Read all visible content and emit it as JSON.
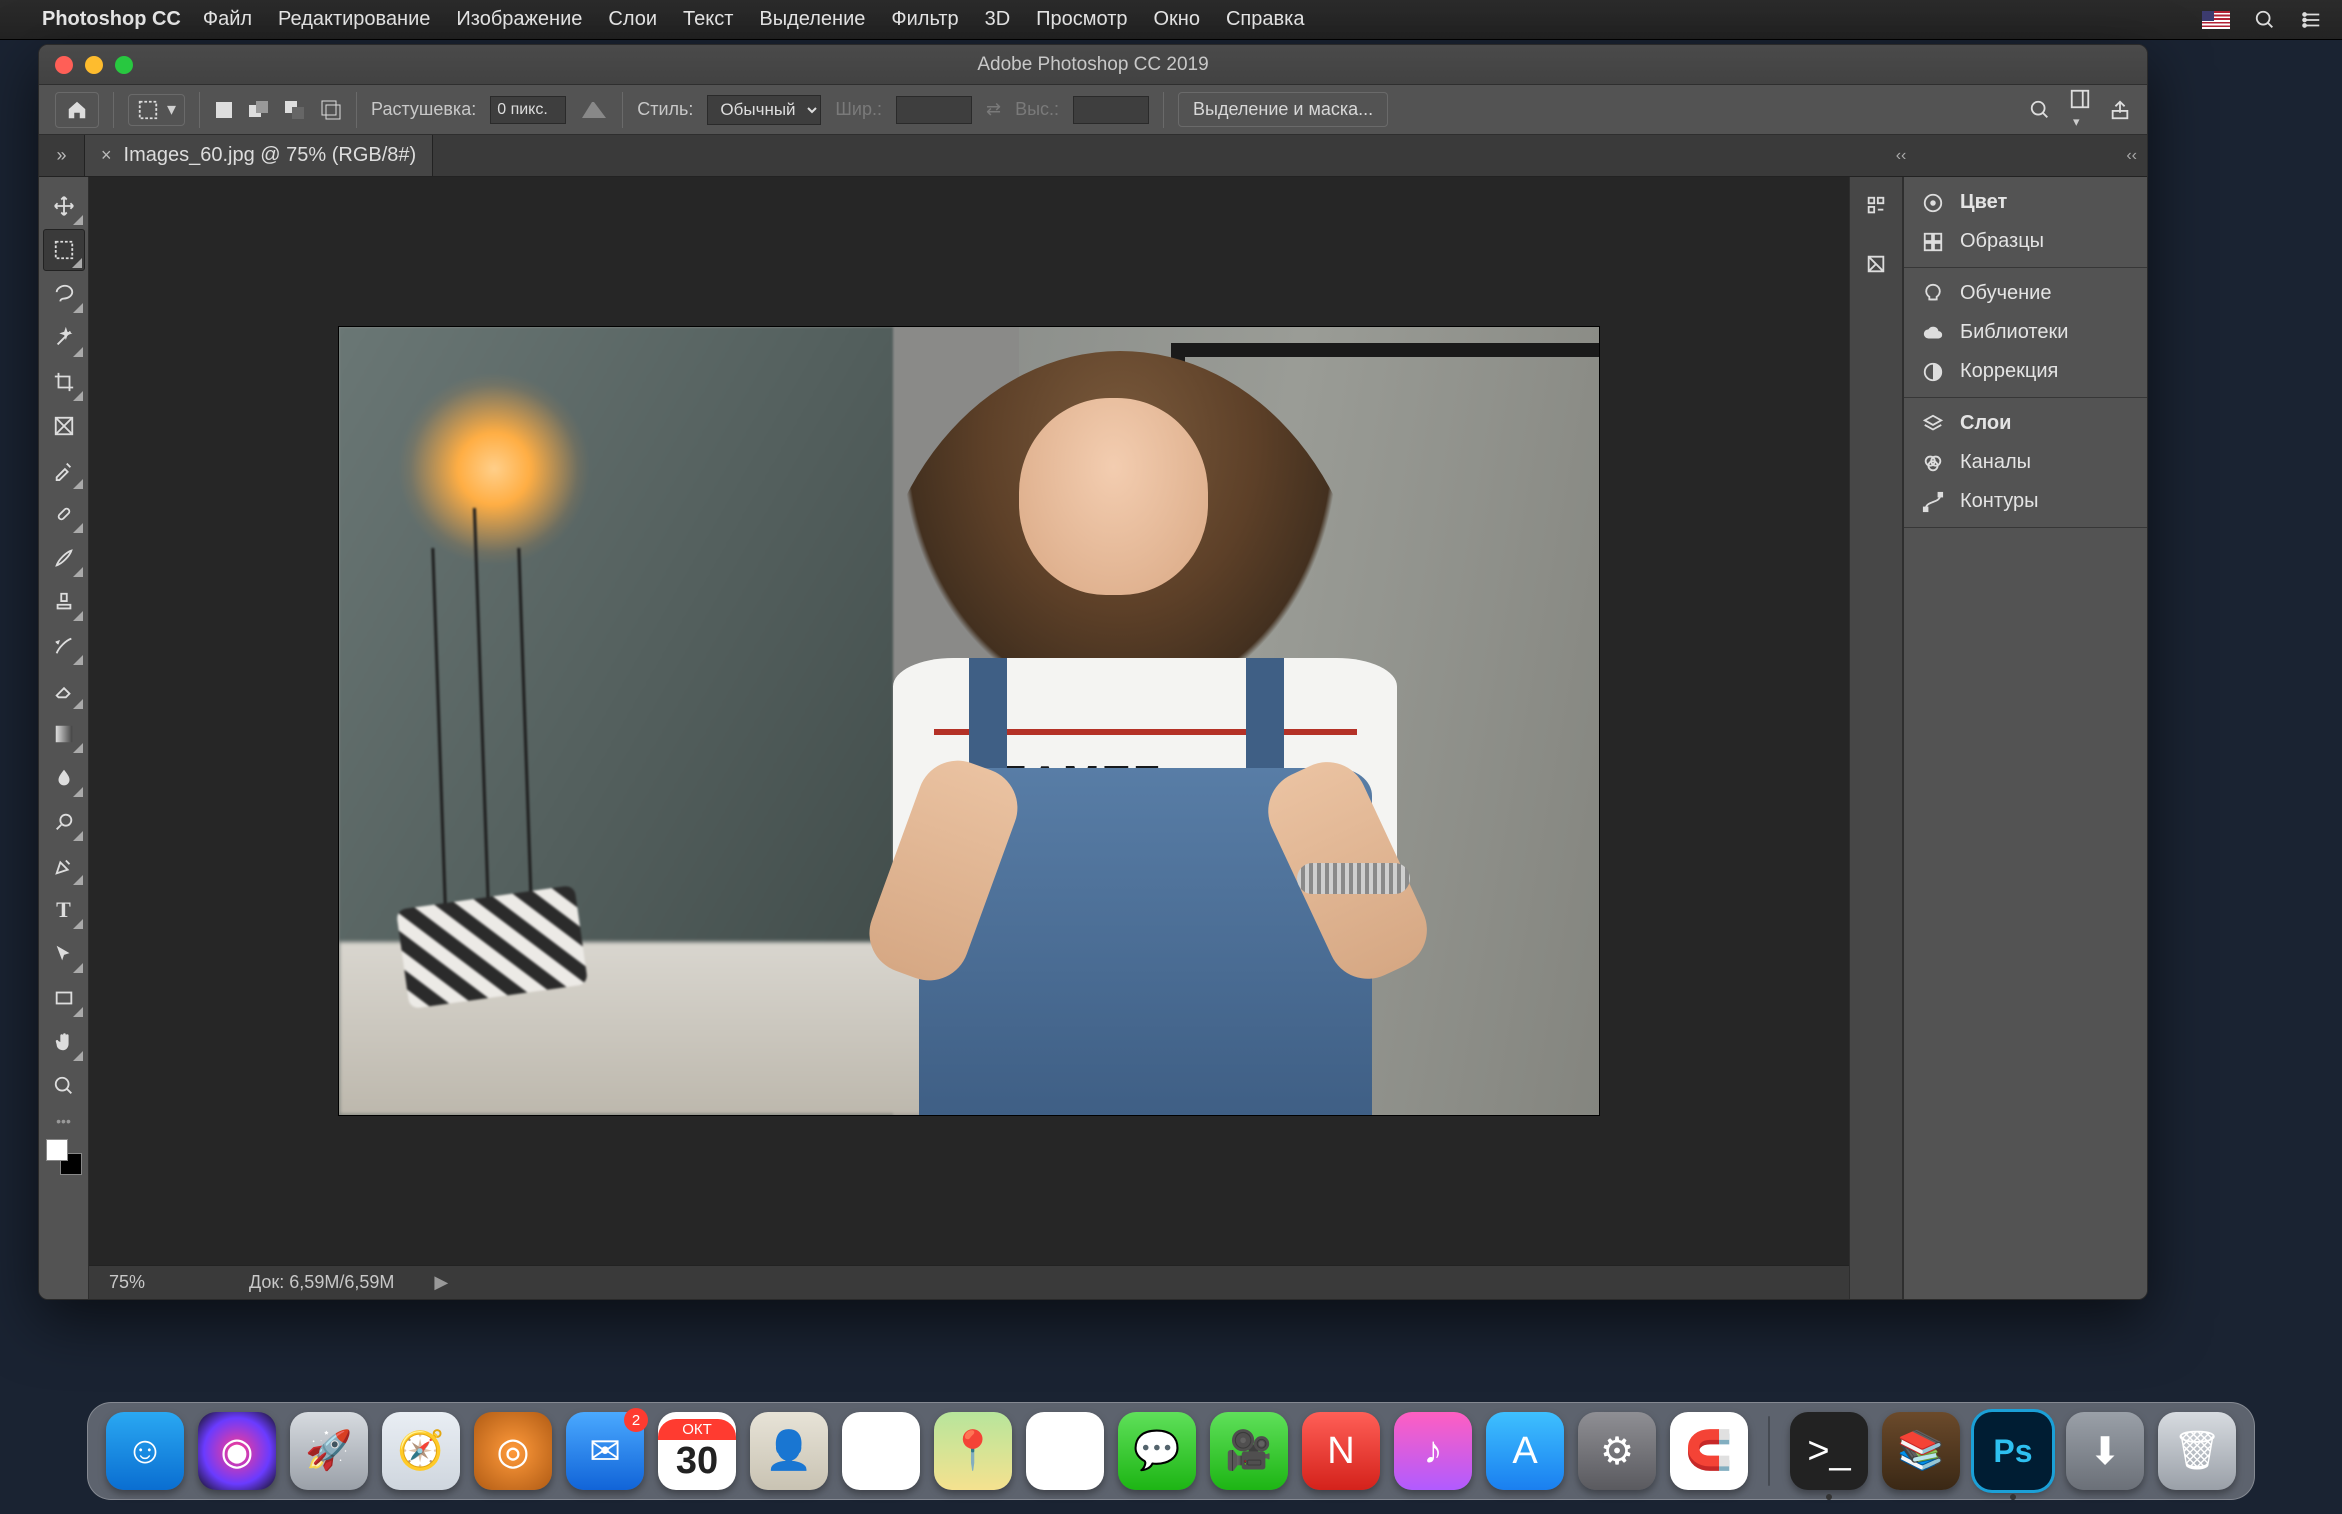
{
  "mac_menu": {
    "app_name": "Photoshop CC",
    "items": [
      "Файл",
      "Редактирование",
      "Изображение",
      "Слои",
      "Текст",
      "Выделение",
      "Фильтр",
      "3D",
      "Просмотр",
      "Окно",
      "Справка"
    ]
  },
  "window": {
    "title": "Adobe Photoshop CC 2019"
  },
  "options": {
    "feather_label": "Растушевка:",
    "feather_value": "0 пикс.",
    "style_label": "Стиль:",
    "style_value": "Обычный",
    "width_label": "Шир.:",
    "height_label": "Выс.:",
    "mask_button": "Выделение и маска..."
  },
  "document_tab": {
    "label": "Images_60.jpg @ 75% (RGB/8#)",
    "close": "×"
  },
  "status": {
    "zoom": "75%",
    "doc_label": "Док:",
    "doc_value": "6,59M/6,59M",
    "tri": "▶"
  },
  "panels": {
    "group1": [
      "Цвет",
      "Образцы"
    ],
    "group2": [
      "Обучение",
      "Библиотеки",
      "Коррекция"
    ],
    "group3": [
      "Слои",
      "Каналы",
      "Контуры"
    ]
  },
  "toolbox": {
    "tools": [
      "move",
      "marquee",
      "lasso",
      "magic-wand",
      "crop",
      "frame",
      "eyedropper",
      "healing",
      "brush",
      "stamp",
      "history-brush",
      "eraser",
      "gradient",
      "blur",
      "dodge",
      "pen",
      "type",
      "path-select",
      "rectangle",
      "hand",
      "zoom"
    ],
    "active": "marquee"
  },
  "photo": {
    "shirt_text": "REAMEF"
  },
  "dock": {
    "items": [
      {
        "name": "finder",
        "bg": "linear-gradient(#2aa8f2,#0a6ed1)",
        "glyph": "☺"
      },
      {
        "name": "siri",
        "bg": "radial-gradient(circle,#ff3b8d,#6a3bff 60%,#111)",
        "glyph": "◉"
      },
      {
        "name": "launchpad",
        "bg": "linear-gradient(#d7dbe0,#9aa0a8)",
        "glyph": "🚀"
      },
      {
        "name": "safari",
        "bg": "linear-gradient(#e9eef4,#cfd6de)",
        "glyph": "🧭"
      },
      {
        "name": "showcase",
        "bg": "radial-gradient(circle,#ff9a3b,#b05b14)",
        "glyph": "◎"
      },
      {
        "name": "mail",
        "bg": "linear-gradient(#4aa9ff,#1164d8)",
        "glyph": "✉",
        "badge": "2"
      },
      {
        "name": "calendar",
        "bg": "#fff",
        "glyph": "",
        "badge": null
      },
      {
        "name": "contacts",
        "bg": "linear-gradient(#e7e3d7,#c9c3b3)",
        "glyph": "👤"
      },
      {
        "name": "reminders",
        "bg": "#fff",
        "glyph": "☲"
      },
      {
        "name": "maps",
        "bg": "linear-gradient(#b7e59b,#f5e28f)",
        "glyph": "📍"
      },
      {
        "name": "photos",
        "bg": "#fff",
        "glyph": "✿"
      },
      {
        "name": "messages",
        "bg": "linear-gradient(#5fe05a,#1db514)",
        "glyph": "💬"
      },
      {
        "name": "facetime",
        "bg": "linear-gradient(#5fe05a,#1db514)",
        "glyph": "🎥"
      },
      {
        "name": "news",
        "bg": "linear-gradient(#ff5f57,#d4221b)",
        "glyph": "N"
      },
      {
        "name": "itunes",
        "bg": "linear-gradient(#ff5fc1,#b15bff)",
        "glyph": "♪"
      },
      {
        "name": "appstore",
        "bg": "linear-gradient(#3ec0ff,#1a7ff0)",
        "glyph": "A"
      },
      {
        "name": "preferences",
        "bg": "linear-gradient(#8f8f94,#5a5a5f)",
        "glyph": "⚙"
      },
      {
        "name": "magnet",
        "bg": "#fff",
        "glyph": "🧲"
      }
    ],
    "right": [
      {
        "name": "terminal",
        "bg": "#222",
        "glyph": ">_",
        "dot": true
      },
      {
        "name": "books",
        "bg": "linear-gradient(#6b4a2b,#3a2815)",
        "glyph": "📚"
      },
      {
        "name": "photoshop",
        "bg": "#001d33",
        "glyph": "Ps",
        "dot": true,
        "active": true
      },
      {
        "name": "downloads",
        "bg": "linear-gradient(#9aa0a8,#6b7078)",
        "glyph": "⬇"
      },
      {
        "name": "trash",
        "bg": "linear-gradient(#d7dbe0,#9aa0a8)",
        "glyph": "🗑"
      }
    ],
    "calendar": {
      "month": "ОКТ",
      "day": "30"
    }
  }
}
